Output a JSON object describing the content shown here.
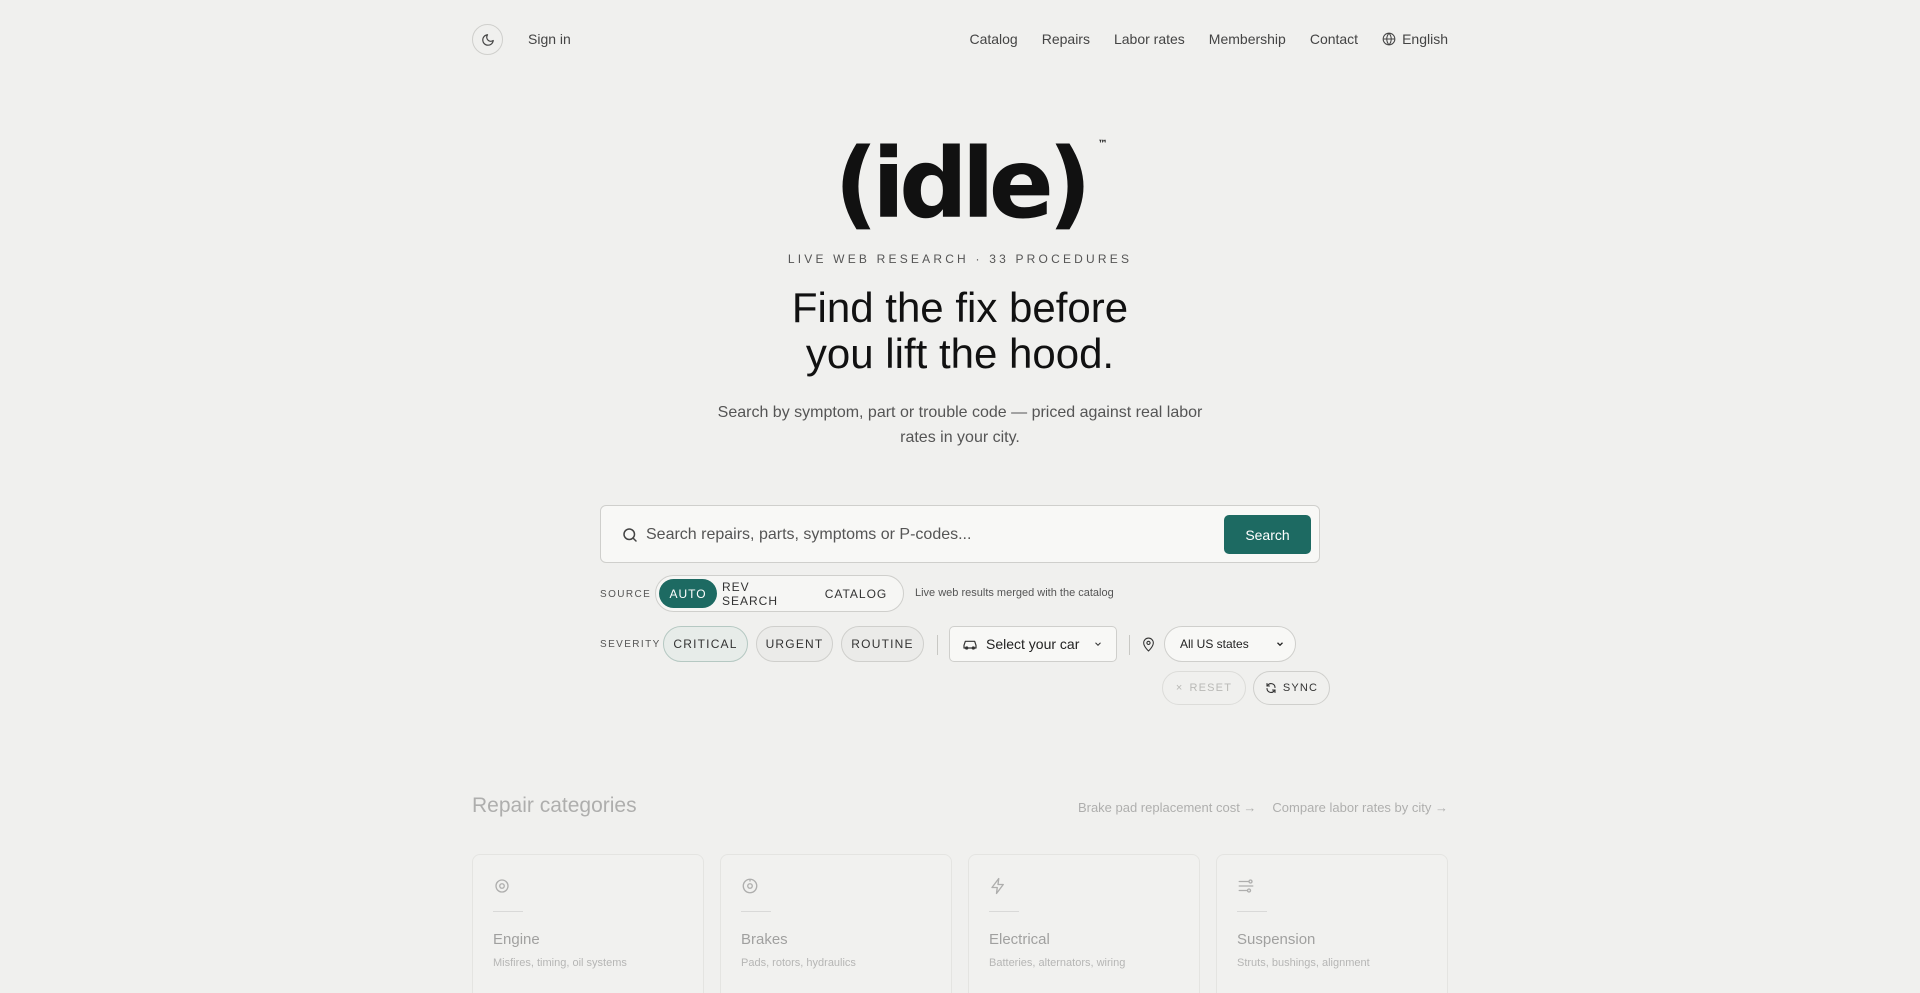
{
  "nav": {
    "signin": "Sign in",
    "links": [
      "Catalog",
      "Repairs",
      "Labor rates",
      "Membership",
      "Contact"
    ],
    "language": "English"
  },
  "hero": {
    "logo": "(idle)",
    "trademark": "™",
    "eyebrow": "LIVE WEB RESEARCH · 33 PROCEDURES",
    "headline_line1": "Find the fix before",
    "headline_line2": "you lift the hood.",
    "subtext": "Search by symptom, part or trouble code — priced against real labor rates in your city."
  },
  "search": {
    "placeholder": "Search repairs, parts, symptoms or P-codes...",
    "button": "Search"
  },
  "source": {
    "label": "SOURCE",
    "options": [
      "AUTO",
      "REV SEARCH",
      "CATALOG"
    ],
    "selected": "AUTO",
    "description": "Live web results merged with the catalog"
  },
  "severity": {
    "label": "SEVERITY",
    "options": [
      "CRITICAL",
      "URGENT",
      "ROUTINE"
    ]
  },
  "filters": {
    "car": "Select your car",
    "state": "All US states",
    "reset": "RESET",
    "sync": "SYNC"
  },
  "categories": {
    "title": "Repair categories",
    "links": [
      "Brake pad replacement cost →",
      "Compare labor rates by city →"
    ],
    "cards": [
      {
        "name": "Engine",
        "desc": "Misfires, timing, oil systems",
        "icon": "engine-icon"
      },
      {
        "name": "Brakes",
        "desc": "Pads, rotors, hydraulics",
        "icon": "brake-icon"
      },
      {
        "name": "Electrical",
        "desc": "Batteries, alternators, wiring",
        "icon": "lightning-icon"
      },
      {
        "name": "Suspension",
        "desc": "Struts, bushings, alignment",
        "icon": "suspension-icon"
      }
    ]
  },
  "colors": {
    "accent": "#1d6a62",
    "background": "#f0f0ee"
  }
}
